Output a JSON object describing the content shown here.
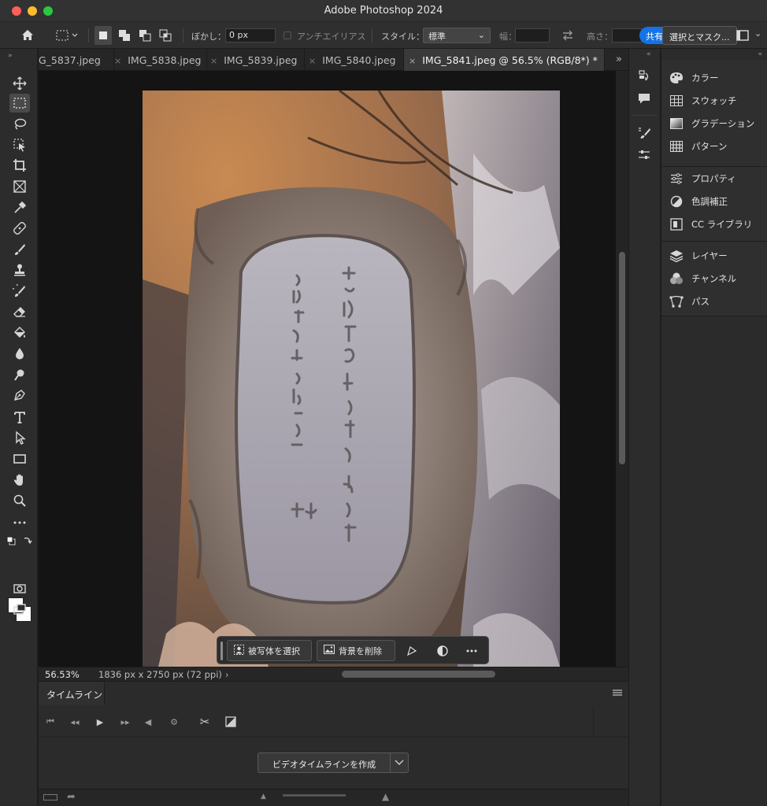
{
  "window": {
    "title": "Adobe Photoshop 2024"
  },
  "options_bar": {
    "feather_label": "ぼかし：",
    "feather_value": "0 px",
    "antialias_label": "アンチエイリアス",
    "style_label": "スタイル：",
    "style_value": "標準",
    "width_label": "幅：",
    "height_label": "高さ：",
    "share_label": "共有",
    "mask_button": "選択とマスク..."
  },
  "tabs": [
    {
      "label": "G_5837.jpeg",
      "active": false
    },
    {
      "label": "IMG_5838.jpeg",
      "active": false
    },
    {
      "label": "IMG_5839.jpeg",
      "active": false
    },
    {
      "label": "IMG_5840.jpeg",
      "active": false
    },
    {
      "label": "IMG_5841.jpeg @ 56.5% (RGB/8*) *",
      "active": true
    }
  ],
  "contextual_bar": {
    "select_subject": "被写体を選択",
    "remove_background": "背景を削除"
  },
  "status": {
    "zoom": "56.53%",
    "dimensions": "1836 px x 2750 px (72 ppi)"
  },
  "timeline": {
    "tab_label": "タイムライン",
    "create_button": "ビデオタイムラインを作成"
  },
  "right_panels": {
    "group1": [
      "カラー",
      "スウォッチ",
      "グラデーション",
      "パターン"
    ],
    "group2": [
      "プロパティ",
      "色調補正",
      "CC ライブラリ"
    ],
    "group3": [
      "レイヤー",
      "チャンネル",
      "パス"
    ]
  },
  "colors": {
    "accent": "#1473e6",
    "panel_bg": "#2b2b2b",
    "canvas_bg": "#141414"
  }
}
